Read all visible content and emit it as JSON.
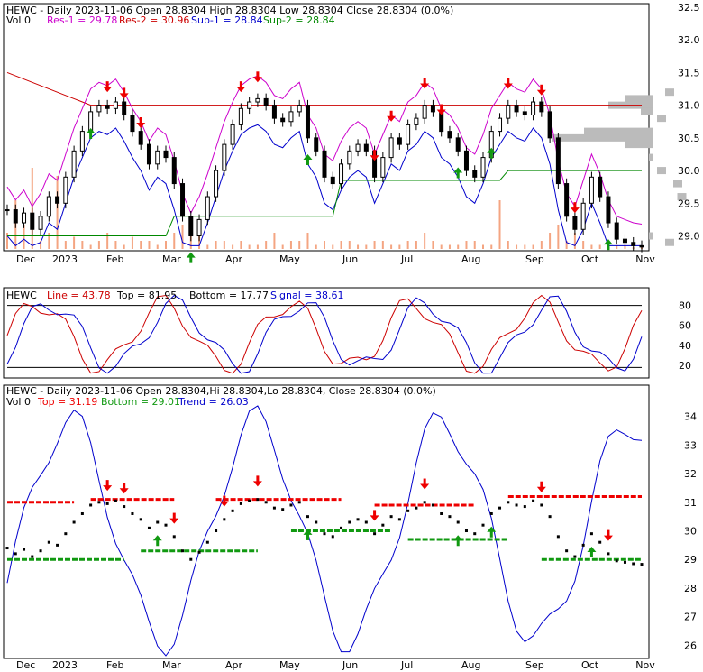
{
  "chart_data": [
    {
      "type": "candlestick",
      "panel": "price",
      "header": {
        "ticker": "HEWC",
        "line1": "HEWC - Daily 2023-11-06 Open 28.8304   High 28.8304   Low 28.8304   Close 28.8304 (0.0%)",
        "vol": "Vol 0",
        "res1": "Res-1 = 29.78",
        "res2": "Res-2 = 30.96",
        "sup1": "Sup-1 = 28.84",
        "sup2": "Sup-2 = 28.84"
      },
      "x_ticks": [
        "Dec",
        "2023",
        "Feb",
        "Mar",
        "Apr",
        "May",
        "Jun",
        "Jul",
        "Aug",
        "Sep",
        "Oct",
        "Nov"
      ],
      "y_ticks": [
        "32.5",
        "32.0",
        "31.5",
        "31.0",
        "30.5",
        "30.0",
        "29.5",
        "29.0"
      ],
      "ylim": [
        28.8,
        32.5
      ],
      "close": [
        29.4,
        29.2,
        29.35,
        29.1,
        29.3,
        29.6,
        29.5,
        29.9,
        30.3,
        30.6,
        30.9,
        31.0,
        30.95,
        31.05,
        30.85,
        30.6,
        30.4,
        30.1,
        30.3,
        30.2,
        29.8,
        29.3,
        29.0,
        29.25,
        29.6,
        30.0,
        30.4,
        30.7,
        30.95,
        31.05,
        31.1,
        31.0,
        30.8,
        30.75,
        30.9,
        31.0,
        30.5,
        30.3,
        29.9,
        29.8,
        30.1,
        30.3,
        30.4,
        30.3,
        29.9,
        30.2,
        30.5,
        30.4,
        30.7,
        30.8,
        31.0,
        30.9,
        30.6,
        30.5,
        30.3,
        30.0,
        29.9,
        30.2,
        30.6,
        30.8,
        31.0,
        30.9,
        30.85,
        31.05,
        30.9,
        30.5,
        29.8,
        29.3,
        29.1,
        29.5,
        29.9,
        29.6,
        29.2,
        28.95,
        28.9,
        28.85,
        28.83
      ],
      "volume_bar_heights_relative": [
        0.2,
        0.6,
        0.3,
        1.0,
        0.1,
        0.2,
        0.9,
        0.1,
        0.15,
        0.1,
        0.05,
        0.1,
        0.2,
        0.1,
        0.05,
        0.15,
        0.1,
        0.1,
        0.05,
        0.1,
        0.2,
        0.3,
        0.2,
        0.3,
        0.05,
        0.1,
        0.1,
        0.05,
        0.1,
        0.05,
        0.05,
        0.1,
        0.2,
        0.05,
        0.1,
        0.1,
        0.2,
        0.05,
        0.1,
        0.05,
        0.1,
        0.1,
        0.05,
        0.05,
        0.1,
        0.1,
        0.05,
        0.05,
        0.1,
        0.1,
        0.2,
        0.1,
        0.05,
        0.05,
        0.05,
        0.1,
        0.1,
        0.05,
        0.05,
        0.6,
        0.1,
        0.05,
        0.05,
        0.05,
        0.1,
        0.2,
        0.3,
        0.1,
        0.2,
        0.1,
        0.05,
        0.05,
        0.1,
        0.05,
        0.05,
        0.02,
        0.02
      ],
      "colors": {
        "res1": "#cc00cc",
        "res2": "#cc0000",
        "sup1": "#0000cc",
        "sup2": "#008800",
        "volume": "#f4a582",
        "profile": "#bbbbbb"
      }
    },
    {
      "type": "line",
      "panel": "stochastic",
      "header": {
        "ticker": "HEWC",
        "line": "Line = 43.78",
        "top": "Top = 81.95",
        "bottom": "Bottom = 17.77",
        "signal": "Signal = 38.61"
      },
      "y_ticks": [
        "80",
        "60",
        "40",
        "20"
      ],
      "ylim": [
        10,
        95
      ],
      "colors": {
        "line": "#cc0000",
        "signal": "#0000cc",
        "bounds": "#000000"
      }
    },
    {
      "type": "line",
      "panel": "trend",
      "header": {
        "line1": "HEWC - Daily 2023-11-06 Open 28.8304,Hi 28.8304,Lo 28.8304, Close 28.8304 (0.0%)",
        "vol": "Vol 0",
        "top": "Top = 31.19",
        "bottom": "Bottom = 29.01",
        "trend": "Trend = 26.03"
      },
      "x_ticks": [
        "Dec",
        "2023",
        "Feb",
        "Mar",
        "Apr",
        "May",
        "Jun",
        "Jul",
        "Aug",
        "Sep",
        "Oct",
        "Nov"
      ],
      "y_ticks": [
        "34",
        "33",
        "32",
        "31",
        "30",
        "29",
        "28",
        "27",
        "26"
      ],
      "ylim": [
        25.6,
        35.0
      ],
      "colors": {
        "top": "#ee0000",
        "bottom": "#119911",
        "trend": "#0000cc"
      }
    }
  ]
}
